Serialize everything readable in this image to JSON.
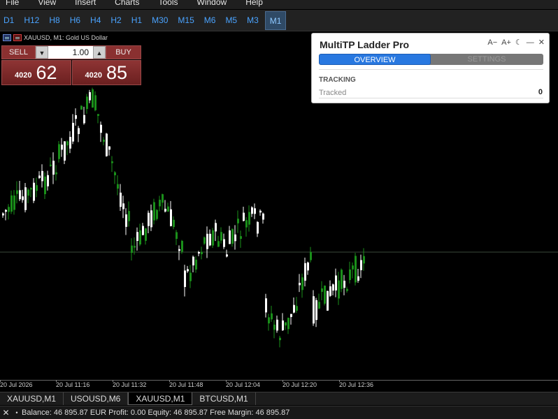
{
  "menu": [
    "File",
    "View",
    "Insert",
    "Charts",
    "Tools",
    "Window",
    "Help"
  ],
  "timeframes": [
    {
      "label": "D1",
      "active": false
    },
    {
      "label": "H12",
      "active": false
    },
    {
      "label": "H8",
      "active": false
    },
    {
      "label": "H6",
      "active": false
    },
    {
      "label": "H4",
      "active": false
    },
    {
      "label": "H2",
      "active": false
    },
    {
      "label": "H1",
      "active": false
    },
    {
      "label": "M30",
      "active": false
    },
    {
      "label": "M15",
      "active": false
    },
    {
      "label": "M6",
      "active": false
    },
    {
      "label": "M5",
      "active": false
    },
    {
      "label": "M3",
      "active": false
    },
    {
      "label": "M1",
      "active": true
    }
  ],
  "chart": {
    "symbol_title": "XAUUSD, M1:  Gold US Dollar",
    "colors": {
      "bull": "#1a8f1a",
      "bear": "#ffffff",
      "level_line": "#3a4a3a",
      "background": "#000000"
    }
  },
  "trade_panel": {
    "sell_label": "SELL",
    "buy_label": "BUY",
    "lot": "1.00",
    "lot_down_icon": "triangle-down-icon",
    "lot_up_icon": "triangle-up-icon",
    "bid_small": "4020",
    "bid_big": "62",
    "ask_small": "4020",
    "ask_big": "85"
  },
  "multitp": {
    "title": "MultiTP Ladder Pro",
    "font_down": "A−",
    "font_up": "A+",
    "theme_icon": "☾",
    "minimize_icon": "—",
    "close_icon": "✕",
    "tabs": [
      {
        "label": "OVERVIEW",
        "active": true
      },
      {
        "label": "SETTINGS",
        "active": false
      }
    ],
    "section": "TRACKING",
    "tracked_label": "Tracked",
    "tracked_value": "0"
  },
  "time_axis": [
    "20 Jul 2026",
    "20 Jul 11:16",
    "20 Jul 11:32",
    "20 Jul 11:48",
    "20 Jul 12:04",
    "20 Jul 12:20",
    "20 Jul 12:36"
  ],
  "chart_tabs": [
    {
      "label": "XAUUSD,M1",
      "active": false
    },
    {
      "label": "USOUSD,M6",
      "active": false
    },
    {
      "label": "XAUUSD,M1",
      "active": true
    },
    {
      "label": "BTCUSD,M1",
      "active": false
    }
  ],
  "status": {
    "close_icon": "✕",
    "dot": "•",
    "text": "Balance: 46 895.87 EUR  Profit: 0.00  Equity: 46 895.87  Free Margin: 46 895.87"
  }
}
